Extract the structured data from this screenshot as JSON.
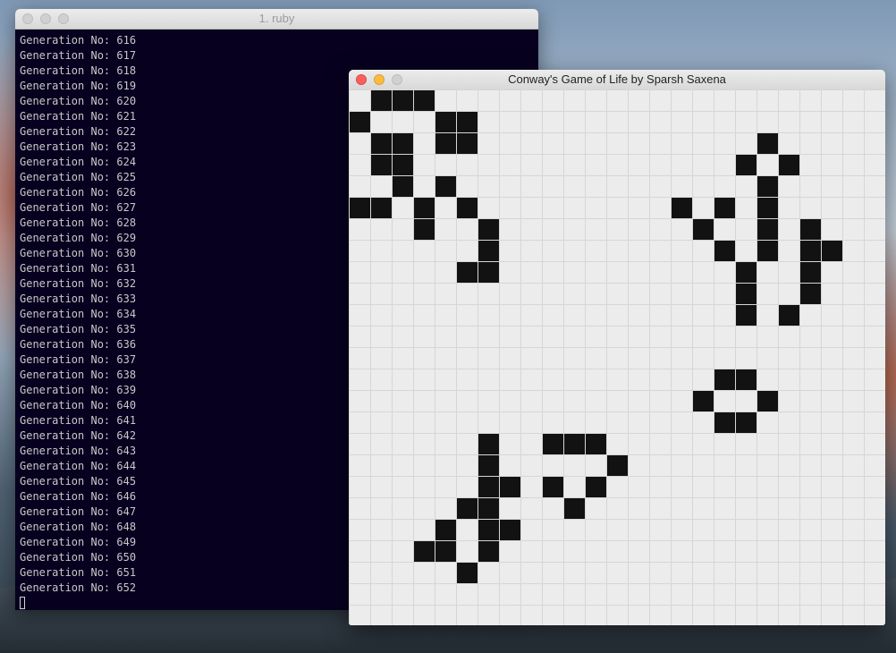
{
  "terminal": {
    "title": "1. ruby",
    "lines": [
      "Generation No: 616",
      "Generation No: 617",
      "Generation No: 618",
      "Generation No: 619",
      "Generation No: 620",
      "Generation No: 621",
      "Generation No: 622",
      "Generation No: 623",
      "Generation No: 624",
      "Generation No: 625",
      "Generation No: 626",
      "Generation No: 627",
      "Generation No: 628",
      "Generation No: 629",
      "Generation No: 630",
      "Generation No: 631",
      "Generation No: 632",
      "Generation No: 633",
      "Generation No: 634",
      "Generation No: 635",
      "Generation No: 636",
      "Generation No: 637",
      "Generation No: 638",
      "Generation No: 639",
      "Generation No: 640",
      "Generation No: 641",
      "Generation No: 642",
      "Generation No: 643",
      "Generation No: 644",
      "Generation No: 645",
      "Generation No: 646",
      "Generation No: 647",
      "Generation No: 648",
      "Generation No: 649",
      "Generation No: 650",
      "Generation No: 651",
      "Generation No: 652"
    ]
  },
  "game": {
    "title": "Conway's Game of Life by Sparsh Saxena",
    "grid_columns": 25,
    "grid_rows": 25,
    "live_cells": [
      [
        0,
        1
      ],
      [
        0,
        2
      ],
      [
        0,
        3
      ],
      [
        1,
        0
      ],
      [
        1,
        4
      ],
      [
        1,
        5
      ],
      [
        2,
        1
      ],
      [
        2,
        2
      ],
      [
        2,
        4
      ],
      [
        2,
        5
      ],
      [
        2,
        19
      ],
      [
        3,
        1
      ],
      [
        3,
        2
      ],
      [
        3,
        18
      ],
      [
        3,
        20
      ],
      [
        4,
        2
      ],
      [
        4,
        4
      ],
      [
        4,
        19
      ],
      [
        5,
        0
      ],
      [
        5,
        1
      ],
      [
        5,
        3
      ],
      [
        5,
        5
      ],
      [
        5,
        15
      ],
      [
        5,
        17
      ],
      [
        5,
        19
      ],
      [
        6,
        3
      ],
      [
        6,
        6
      ],
      [
        6,
        16
      ],
      [
        6,
        19
      ],
      [
        6,
        21
      ],
      [
        7,
        6
      ],
      [
        7,
        17
      ],
      [
        7,
        19
      ],
      [
        7,
        21
      ],
      [
        7,
        22
      ],
      [
        8,
        5
      ],
      [
        8,
        6
      ],
      [
        8,
        18
      ],
      [
        8,
        21
      ],
      [
        9,
        18
      ],
      [
        9,
        21
      ],
      [
        10,
        18
      ],
      [
        10,
        20
      ],
      [
        13,
        17
      ],
      [
        13,
        18
      ],
      [
        14,
        16
      ],
      [
        14,
        19
      ],
      [
        15,
        17
      ],
      [
        15,
        18
      ],
      [
        16,
        6
      ],
      [
        16,
        9
      ],
      [
        16,
        10
      ],
      [
        16,
        11
      ],
      [
        17,
        6
      ],
      [
        17,
        12
      ],
      [
        18,
        6
      ],
      [
        18,
        7
      ],
      [
        18,
        9
      ],
      [
        18,
        11
      ],
      [
        19,
        5
      ],
      [
        19,
        6
      ],
      [
        19,
        10
      ],
      [
        20,
        4
      ],
      [
        20,
        6
      ],
      [
        20,
        7
      ],
      [
        21,
        3
      ],
      [
        21,
        4
      ],
      [
        21,
        6
      ],
      [
        22,
        5
      ]
    ],
    "colors": {
      "live": "#121212",
      "dead": "#ececec",
      "gridline": "#d6d6d6"
    }
  }
}
